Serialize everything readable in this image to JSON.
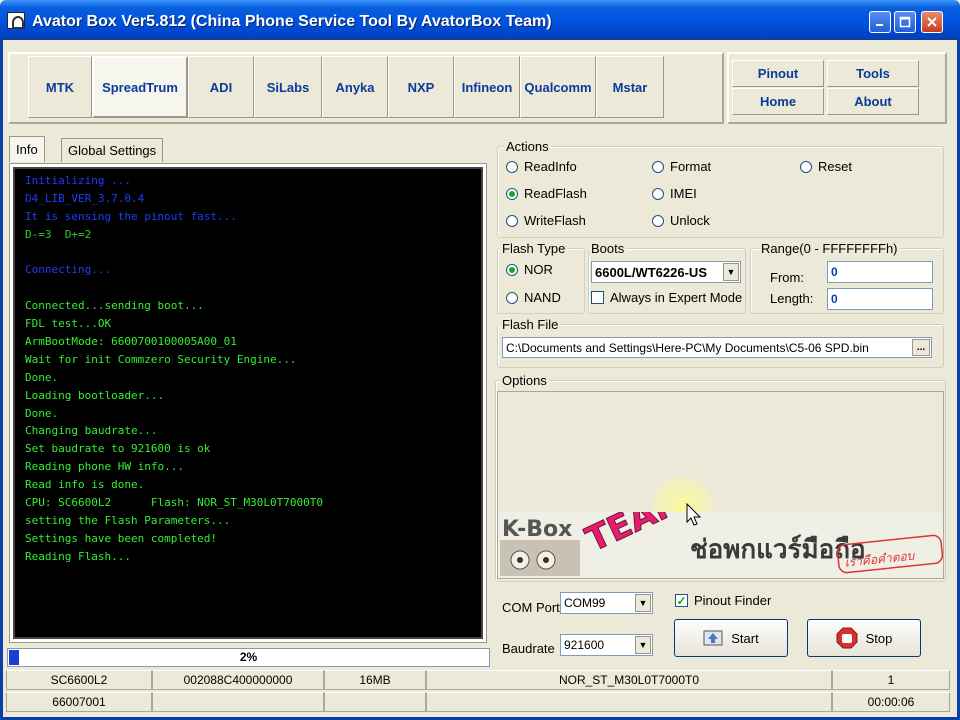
{
  "window": {
    "title": "Avator Box Ver5.812 (China Phone Service Tool By AvatorBox Team)",
    "controls": [
      "minimize",
      "maximize",
      "close"
    ]
  },
  "chipsets": {
    "tabs": [
      "MTK",
      "SpreadTrum",
      "ADI",
      "SiLabs",
      "Anyka",
      "NXP",
      "Infineon",
      "Qualcomm",
      "Mstar"
    ],
    "active": "SpreadTrum"
  },
  "nav": {
    "pinout": "Pinout",
    "tools": "Tools",
    "home": "Home",
    "about": "About"
  },
  "info_tabs": {
    "info": "Info",
    "global_settings": "Global Settings",
    "active": "Info"
  },
  "log": [
    {
      "text": "Initializing ...",
      "color": "#1e3cff"
    },
    {
      "text": "D4_LIB_VER_3.7.0.4",
      "color": "#1e3cff"
    },
    {
      "text": "It is sensing the pinout fast...",
      "color": "#1e3cff"
    },
    {
      "text": "D-=3  D+=2",
      "color": "#33cc33"
    },
    {
      "text": "",
      "color": "#33cc33"
    },
    {
      "text": "Connecting...",
      "color": "#1e3cff"
    },
    {
      "text": "",
      "color": "#33cc33"
    },
    {
      "text": "Connected...sending boot...",
      "color": "#33ee33"
    },
    {
      "text": "FDL test...OK",
      "color": "#33ee33"
    },
    {
      "text": "ArmBootMode: 6600700100005A00_01",
      "color": "#33ee33"
    },
    {
      "text": "Wait for init Commzero Security Engine...",
      "color": "#33ee33"
    },
    {
      "text": "Done.",
      "color": "#33ee33"
    },
    {
      "text": "Loading bootloader...",
      "color": "#33ee33"
    },
    {
      "text": "Done.",
      "color": "#33ee33"
    },
    {
      "text": "Changing baudrate...",
      "color": "#33ee33"
    },
    {
      "text": "Set baudrate to 921600 is ok",
      "color": "#33ee33"
    },
    {
      "text": "Reading phone HW info...",
      "color": "#33ee33"
    },
    {
      "text": "Read info is done.",
      "color": "#33ee33"
    },
    {
      "text": "CPU: SC6600L2      Flash: NOR_ST_M30L0T7000T0",
      "color": "#33ee33"
    },
    {
      "text": "setting the Flash Parameters...",
      "color": "#33ee33"
    },
    {
      "text": "Settings have been completed!",
      "color": "#33ee33"
    },
    {
      "text": "Reading Flash...",
      "color": "#33ee33"
    }
  ],
  "progress": {
    "percent": 2,
    "label": "2%"
  },
  "actions": {
    "label": "Actions",
    "options": [
      "ReadInfo",
      "Format",
      "Reset",
      "ReadFlash",
      "IMEI",
      "WriteFlash",
      "Unlock"
    ],
    "selected": "ReadFlash"
  },
  "flash_type": {
    "label": "Flash Type",
    "options": [
      "NOR",
      "NAND"
    ],
    "selected": "NOR"
  },
  "boots": {
    "label": "Boots",
    "selected": "6600L/WT6226-US",
    "expert_mode_label": "Always in Expert Mode",
    "expert_mode": false
  },
  "range": {
    "label": "Range(0 - FFFFFFFFh)",
    "from_label": "From:",
    "from": "0",
    "length_label": "Length:",
    "length": "0"
  },
  "flash_file": {
    "label": "Flash File",
    "path": "C:\\Documents and Settings\\Here-PC\\My Documents\\C5-06 SPD.bin",
    "browse": "..."
  },
  "options": {
    "label": "Options",
    "banner_left": "K-Box",
    "banner_mid": "TEAM",
    "banner_thai": "ช่อพกแวร์มือถือ",
    "banner_tag": "เราคือคำตอบ"
  },
  "com": {
    "label": "COM Port",
    "value": "COM99",
    "baud_label": "Baudrate",
    "baud": "921600",
    "pinout_finder": "Pinout Finder",
    "pinout_finder_checked": true
  },
  "buttons": {
    "start": "Start",
    "stop": "Stop"
  },
  "status": {
    "row1": [
      "SC6600L2",
      "002088C400000000",
      "16MB",
      "NOR_ST_M30L0T7000T0",
      "1"
    ],
    "row2": [
      "66007001",
      "",
      "",
      "",
      "00:00:06"
    ]
  }
}
